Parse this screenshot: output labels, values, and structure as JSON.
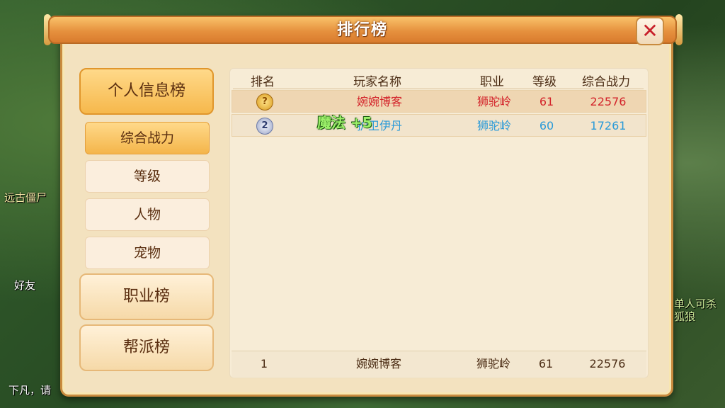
{
  "background": {
    "left_texts": [
      "远古僵尸",
      "好友",
      "下凡，请"
    ],
    "right_texts": [
      "单人可杀",
      "狐狼"
    ]
  },
  "window": {
    "title": "排行榜",
    "close_icon": "close-icon"
  },
  "sidebar": {
    "main_tabs": [
      {
        "label": "个人信息榜",
        "active": true
      },
      {
        "label": "职业榜",
        "active": false
      },
      {
        "label": "帮派榜",
        "active": false
      }
    ],
    "sub_tabs": [
      {
        "label": "综合战力",
        "active": true
      },
      {
        "label": "等级",
        "active": false
      },
      {
        "label": "人物",
        "active": false
      },
      {
        "label": "宠物",
        "active": false
      }
    ]
  },
  "table": {
    "headers": [
      "排名",
      "玩家名称",
      "职业",
      "等级",
      "综合战力"
    ],
    "rows": [
      {
        "rank": "1",
        "rank_icon": "gold-medal-icon",
        "name": "婉婉博客",
        "job": "狮驼岭",
        "level": "61",
        "power": "22576",
        "color": "#d3232a"
      },
      {
        "rank": "2",
        "rank_icon": "silver-medal-icon",
        "name": "护卫伊丹",
        "job": "狮驼岭",
        "level": "60",
        "power": "17261",
        "color": "#2a9ad8"
      }
    ],
    "floating_text": "魔法 +5",
    "my_rank": {
      "rank": "1",
      "name": "婉婉博客",
      "job": "狮驼岭",
      "level": "61",
      "power": "22576"
    }
  }
}
